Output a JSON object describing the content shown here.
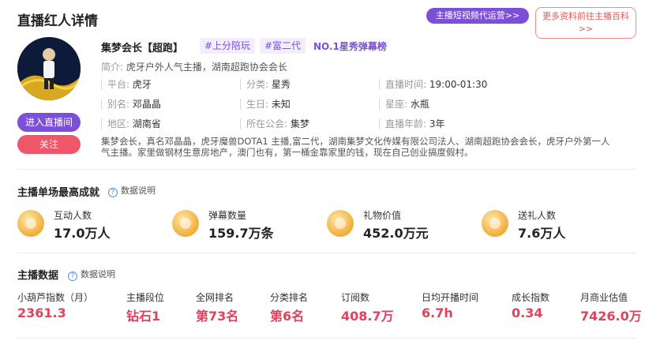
{
  "header": {
    "title": "直播红人详情",
    "short_video_button": "主播短视频代运营>>",
    "wiki_button_line1": "更多资料前往主播百科",
    "wiki_button_line2": ">>"
  },
  "profile": {
    "name": "集梦会长【超跑】",
    "tags": [
      "#上分陪玩",
      "#富二代"
    ],
    "rank_tag": "NO.1星秀弹幕榜",
    "intro_key": "简介:",
    "intro_value": "虎牙户外人气主播，湖南超跑协会会长",
    "enter_button": "进入直播间",
    "follow_button": "关注",
    "info": {
      "platform_key": "平台:",
      "platform_value": "虎牙",
      "category_key": "分类:",
      "category_value": "星秀",
      "live_time_key": "直播时间:",
      "live_time_value": "19:00-01:30",
      "alias_key": "别名:",
      "alias_value": "邓晶晶",
      "birthday_key": "生日:",
      "birthday_value": "未知",
      "zodiac_key": "星座:",
      "zodiac_value": "水瓶",
      "region_key": "地区:",
      "region_value": "湖南省",
      "guild_key": "所在公会:",
      "guild_value": "集梦",
      "years_key": "直播年龄:",
      "years_value": "3年"
    },
    "description_line1": "集梦会长，真名邓晶晶，虎牙魔兽DOTA1 主播,富二代，湖南集梦文化传媒有限公司法人、湖南超跑协会会长，虎牙户外第一人",
    "description_line2": "气主播。家里做钢材生意房地产，澳门也有，第一桶金靠家里的钱，现在自己创业搞度假村。"
  },
  "best_record": {
    "title": "主播单场最高成就",
    "help": "数据说明",
    "stats": [
      {
        "label": "互动人数",
        "value": "17.0万人"
      },
      {
        "label": "弹幕数量",
        "value": "159.7万条"
      },
      {
        "label": "礼物价值",
        "value": "452.0万元"
      },
      {
        "label": "送礼人数",
        "value": "7.6万人"
      }
    ]
  },
  "anchor_data": {
    "title": "主播数据",
    "help": "数据说明",
    "items": [
      {
        "label": "小葫芦指数（月）",
        "value": "2361.3"
      },
      {
        "label": "主播段位",
        "value": "钻石1"
      },
      {
        "label": "全网排名",
        "value": "第73名"
      },
      {
        "label": "分类排名",
        "value": "第6名"
      },
      {
        "label": "订阅数",
        "value": "408.7万"
      },
      {
        "label": "日均开播时间",
        "value": "6.7h"
      },
      {
        "label": "成长指数",
        "value": "0.34"
      },
      {
        "label": "月商业估值",
        "value": "7426.0万"
      }
    ]
  },
  "colors": {
    "purple": "#7b4fd8",
    "red": "#e0425c",
    "follow": "#f0566a"
  }
}
